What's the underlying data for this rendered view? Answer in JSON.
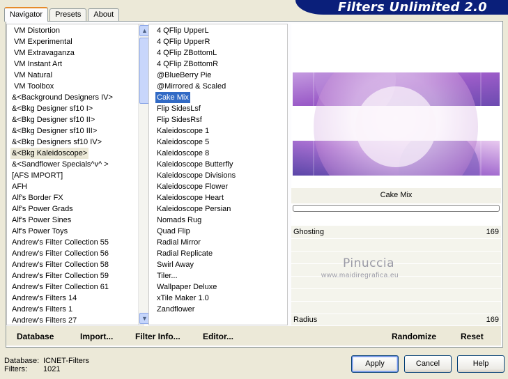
{
  "header": {
    "title": "Filters Unlimited 2.0"
  },
  "tabs": [
    "Navigator",
    "Presets",
    "About"
  ],
  "categories": [
    "VM Distortion",
    "VM Experimental",
    "VM Extravaganza",
    "VM Instant Art",
    "VM Natural",
    "VM Toolbox",
    "&<Background Designers IV>",
    "&<Bkg Designer sf10 I>",
    "&<Bkg Designer sf10 II>",
    "&<Bkg Designer sf10 III>",
    "&<Bkg Designers sf10 IV>",
    "&<Bkg Kaleidoscope>",
    "&<Sandflower Specials^v^ >",
    "[AFS IMPORT]",
    "AFH",
    "Alf's Border FX",
    "Alf's Power Grads",
    "Alf's Power Sines",
    "Alf's Power Toys",
    "Andrew's Filter Collection 55",
    "Andrew's Filter Collection 56",
    "Andrew's Filter Collection 58",
    "Andrew's Filter Collection 59",
    "Andrew's Filter Collection 61",
    "Andrew's Filters 14",
    "Andrew's Filters 1",
    "Andrew's Filters 27"
  ],
  "selected_category": "&<Bkg Kaleidoscope>",
  "filters": [
    "4 QFlip UpperL",
    "4 QFlip UpperR",
    "4 QFlip ZBottomL",
    "4 QFlip ZBottomR",
    "@BlueBerry Pie",
    "@Mirrored & Scaled",
    "Cake Mix",
    "Flip SidesLsf",
    "Flip SidesRsf",
    "Kaleidoscope 1",
    "Kaleidoscope 5",
    "Kaleidoscope 8",
    "Kaleidoscope Butterfly",
    "Kaleidoscope Divisions",
    "Kaleidoscope Flower",
    "Kaleidoscope Heart",
    "Kaleidoscope Persian",
    "Nomads Rug",
    "Quad Flip",
    "Radial Mirror",
    "Radial Replicate",
    "Swirl Away",
    "Tiler...",
    "Wallpaper Deluxe",
    "xTile Maker 1.0",
    "Zandflower"
  ],
  "selected_filter": "Cake Mix",
  "preview": {
    "caption": "Cake Mix"
  },
  "sliders": [
    {
      "label": "Ghosting",
      "value": "169"
    },
    {
      "label": "Radius",
      "value": "169"
    }
  ],
  "watermark": {
    "name": "Pinuccia",
    "url": "www.maidiregrafica.eu"
  },
  "bottom_buttons": {
    "database": "Database",
    "import": "Import...",
    "filter_info": "Filter Info...",
    "editor": "Editor...",
    "randomize": "Randomize",
    "reset": "Reset"
  },
  "status": {
    "database_label": "Database:",
    "database_value": "ICNET-Filters",
    "filters_label": "Filters:",
    "filters_value": "1021"
  },
  "dialog_buttons": {
    "apply": "Apply",
    "cancel": "Cancel",
    "help": "Help"
  }
}
